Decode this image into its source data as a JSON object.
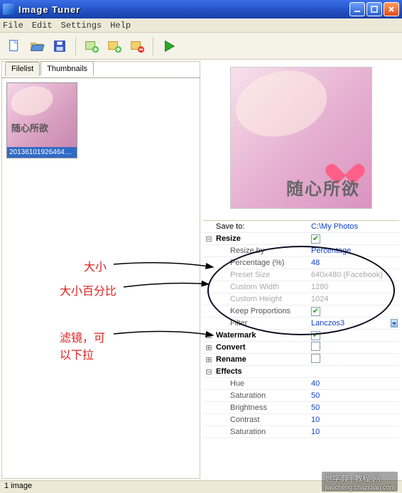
{
  "window": {
    "title": "Image Tuner"
  },
  "menu": {
    "file": "File",
    "edit": "Edit",
    "settings": "Settings",
    "help": "Help"
  },
  "tabs": {
    "filelist": "Filelist",
    "thumbnails": "Thumbnails"
  },
  "thumb": {
    "overlay_text": "随心所欲",
    "filename": "2013610192646468..."
  },
  "preview": {
    "overlay_text": "随心所欲"
  },
  "props": {
    "save_to_label": "Save to:",
    "save_to_value": "C:\\My Photos",
    "resize": {
      "label": "Resize",
      "checked": true,
      "resize_by_label": "Resize by",
      "resize_by_value": "Percentage",
      "percentage_label": "Percentage (%)",
      "percentage_value": "48",
      "preset_label": "Preset Size",
      "preset_value": "640x480 (Facebook)",
      "cw_label": "Custom Width",
      "cw_value": "1280",
      "ch_label": "Custom Height",
      "ch_value": "1024",
      "keep_label": "Keep Proportions",
      "keep_checked": true,
      "filter_label": "Filter",
      "filter_value": "Lanczos3"
    },
    "watermark": {
      "label": "Watermark",
      "checked": true
    },
    "convert": {
      "label": "Convert",
      "checked": false
    },
    "rename": {
      "label": "Rename",
      "checked": false
    },
    "effects": {
      "label": "Effects",
      "hue_label": "Hue",
      "hue_value": "40",
      "sat_label": "Saturation",
      "sat_value": "50",
      "bri_label": "Brightness",
      "bri_value": "50",
      "con_label": "Contrast",
      "con_value": "10",
      "sat2_label": "Saturation",
      "sat2_value": "10"
    }
  },
  "annotations": {
    "size": "大小",
    "size_pct": "大小百分比",
    "filter1": "滤镜，可",
    "filter2": "以下拉"
  },
  "status": {
    "text": "1 image"
  },
  "watermark_site": {
    "l1": "世字典 | 教程 网",
    "l2": "jiaocheng.chazidian.com"
  }
}
